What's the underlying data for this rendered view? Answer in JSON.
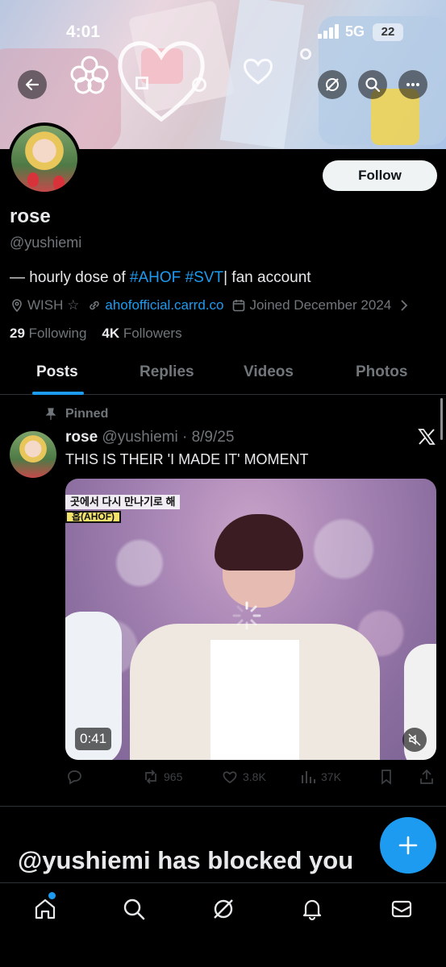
{
  "status_bar": {
    "time": "4:01",
    "network": "5G",
    "battery": "22"
  },
  "profile": {
    "name": "rose",
    "handle": "@yushiemi",
    "follow_label": "Follow",
    "bio_prefix": "— hourly dose of ",
    "bio_tag1": "#AHOF",
    "bio_tag2": "#SVT",
    "bio_suffix": "| fan account",
    "location": "WISH ☆",
    "link": "ahofofficial.carrd.co",
    "joined": "Joined December 2024",
    "following_count": "29",
    "following_label": "Following",
    "followers_count": "4K",
    "followers_label": "Followers"
  },
  "tabs": [
    "Posts",
    "Replies",
    "Videos",
    "Photos"
  ],
  "post": {
    "pinned_label": "Pinned",
    "author_name": "rose",
    "author_handle_date": "@yushiemi · 8/9/25",
    "text": "THIS IS THEIR 'I MADE IT' MOMENT",
    "video_caption_1": "곳에서 다시 만나기로 해",
    "video_caption_2": "홉(AHOF)",
    "video_duration": "0:41",
    "reposts": "965",
    "likes": "3.8K",
    "views": "37K"
  },
  "blocked_message": "@yushiemi has blocked you",
  "colors": {
    "accent": "#1d9bf0",
    "background": "#000000",
    "muted": "#71767b"
  },
  "icons": [
    "back-arrow-icon",
    "grok-icon",
    "search-icon",
    "more-icon",
    "location-icon",
    "link-icon",
    "calendar-icon",
    "pin-icon",
    "x-logo-icon",
    "reply-icon",
    "repost-icon",
    "like-icon",
    "views-icon",
    "bookmark-icon",
    "share-icon",
    "plus-icon",
    "home-icon",
    "grok-nav-icon",
    "bell-icon",
    "mail-icon"
  ]
}
